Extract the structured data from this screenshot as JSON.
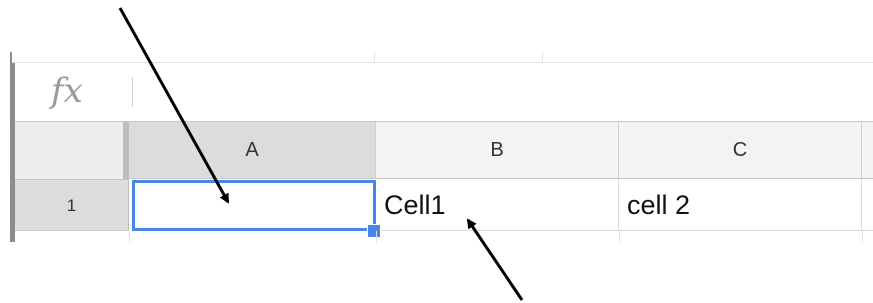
{
  "formula_bar": {
    "fx_label": "fx",
    "value": ""
  },
  "columns": [
    {
      "label": "A",
      "selected": true
    },
    {
      "label": "B",
      "selected": false
    },
    {
      "label": "C",
      "selected": false
    }
  ],
  "rows": [
    {
      "label": "1",
      "cells": [
        "",
        "Cell1",
        "cell 2"
      ]
    }
  ],
  "selection": {
    "cell": "A1",
    "color": "#4a86e8"
  },
  "icons": {
    "fx": "function-icon",
    "fill_handle": "fill-handle-icon",
    "arrow": "arrow-icon"
  }
}
